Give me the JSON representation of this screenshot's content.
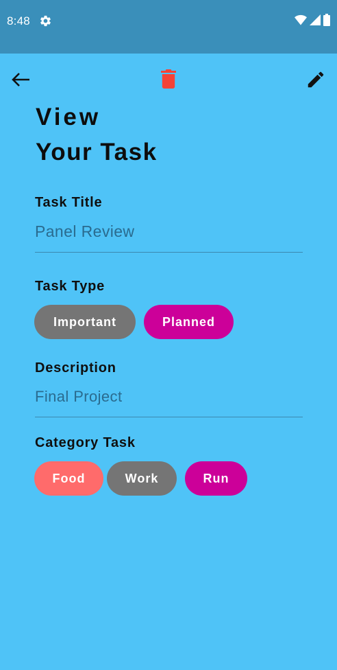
{
  "status_bar": {
    "time": "8:48",
    "icons": [
      "settings-icon",
      "wifi-icon",
      "signal-icon",
      "battery-icon"
    ]
  },
  "app_bar": {
    "icons": [
      "back-arrow-icon",
      "trash-icon",
      "pencil-icon"
    ],
    "delete_color": "#f44336"
  },
  "heading": {
    "line1": "View",
    "line2": "Your Task"
  },
  "task_title": {
    "label": "Task Title",
    "value": "Panel Review"
  },
  "task_type": {
    "label": "Task Type",
    "chips": [
      {
        "label": "Important",
        "color": "#757575",
        "selected": false
      },
      {
        "label": "Planned",
        "color": "#cc0099",
        "selected": true
      }
    ]
  },
  "description": {
    "label": "Description",
    "value": "Final Project"
  },
  "category": {
    "label": "Category Task",
    "chips": [
      {
        "label": "Food",
        "color": "#ff6b6b"
      },
      {
        "label": "Work",
        "color": "#757575"
      },
      {
        "label": "Run",
        "color": "#cc0099"
      }
    ]
  },
  "colors": {
    "background": "#4fc3f7",
    "status_bar": "#3a8fba",
    "value_text": "#2a6b8f"
  }
}
